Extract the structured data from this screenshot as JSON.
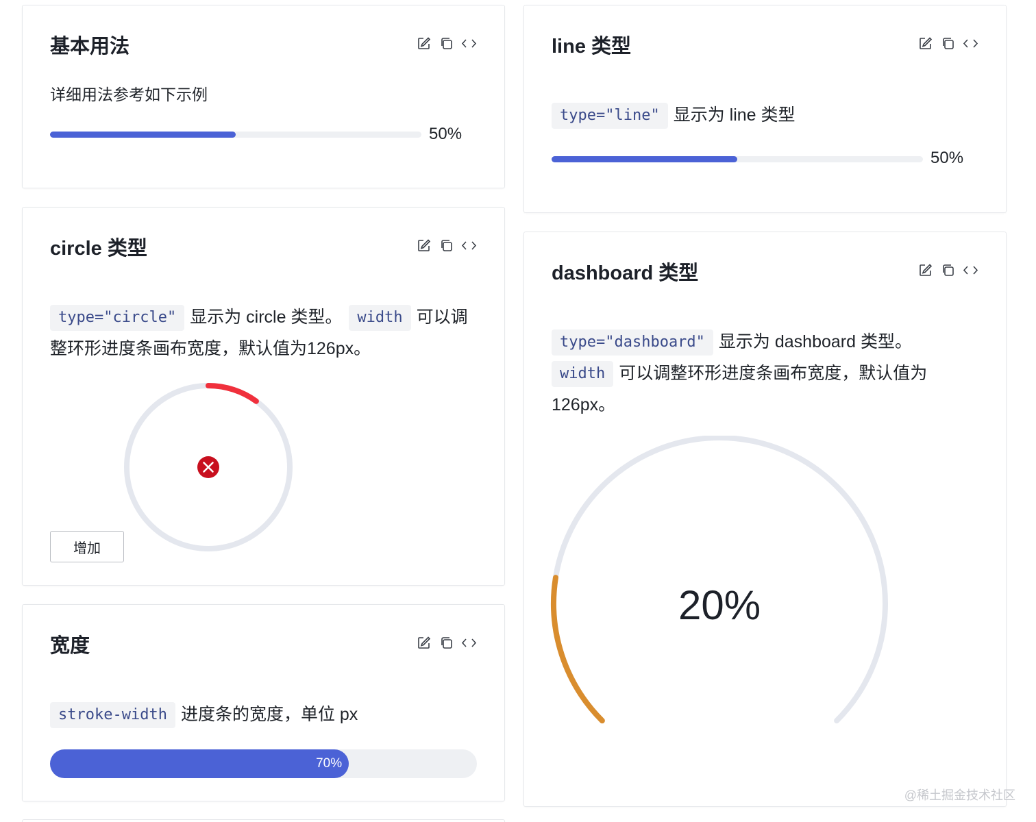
{
  "colors": {
    "accent": "#4b62d6",
    "track": "#eef0f3",
    "error": "#f0303c",
    "error_icon": "#c80f1e",
    "dashboard_arc": "#d98d2e",
    "ring_track": "#e4e7ee"
  },
  "icons": [
    "edit-icon",
    "copy-icon",
    "code-icon"
  ],
  "basic": {
    "title": "基本用法",
    "desc": "详细用法参考如下示例",
    "progress": 0.5,
    "pct_label": "50%"
  },
  "line": {
    "title": "line 类型",
    "code": "type=\"line\"",
    "desc": "显示为 line 类型",
    "progress": 0.5,
    "pct_label": "50%"
  },
  "circle": {
    "title": "circle 类型",
    "code1": "type=\"circle\"",
    "text1": "显示为 circle 类型。",
    "code2": "width",
    "text2a": "可以调",
    "text2b": "整环形进度条画布宽度，默认值为126px。",
    "progress": 0.1,
    "status": "exception",
    "button_label": "增加"
  },
  "dashboard": {
    "title": "dashboard 类型",
    "code1": "type=\"dashboard\"",
    "text1": "显示为 dashboard 类型。",
    "code2": "width",
    "text2": "可以调整环形进度条画布宽度，默认值为",
    "text3": "126px。",
    "progress": 0.2,
    "pct_label": "20%"
  },
  "width_demo": {
    "title": "宽度",
    "code": "stroke-width",
    "desc": "进度条的宽度，单位 px",
    "progress": 0.7,
    "pct_label": "70%"
  },
  "watermark": "@稀土掘金技术社区"
}
